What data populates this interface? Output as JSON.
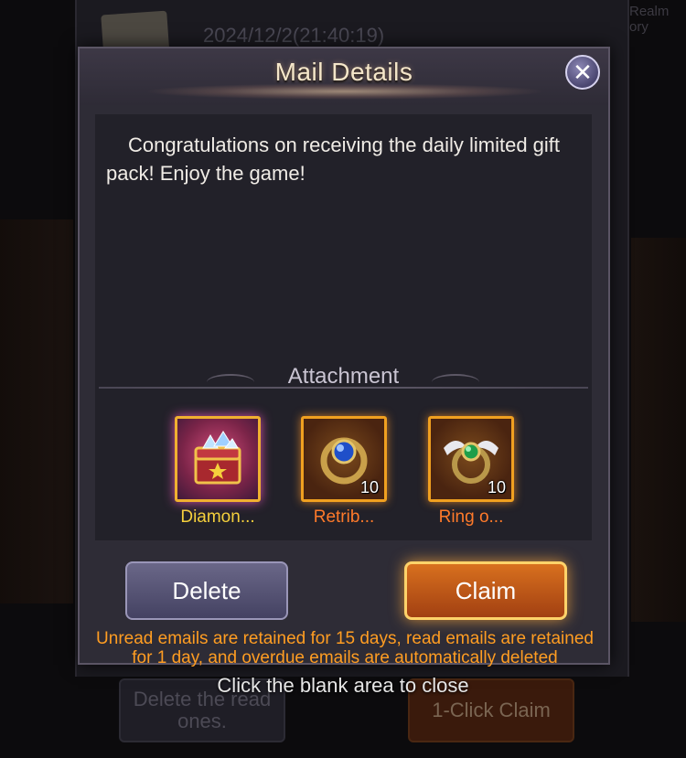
{
  "background": {
    "mail_date": "2024/12/2(21:40:19)",
    "side_text": "Realm ory",
    "delete_read_label": "Delete the read ones.",
    "one_click_claim_label": "1-Click Claim"
  },
  "dialog": {
    "title": "Mail Details",
    "close_icon": "close-x-icon",
    "message": "Congratulations on receiving the daily limited gift pack! Enjoy the game!",
    "attachment_label": "Attachment",
    "attachments": [
      {
        "name": "Diamon...",
        "count": "",
        "icon": "diamond-chest-icon",
        "rarity_color": "#e8409a"
      },
      {
        "name": "Retrib...",
        "count": "10",
        "icon": "blue-gem-ring-icon",
        "rarity_color": "#f0a020"
      },
      {
        "name": "Ring o...",
        "count": "10",
        "icon": "winged-green-ring-icon",
        "rarity_color": "#f0a020"
      }
    ],
    "delete_label": "Delete",
    "claim_label": "Claim",
    "retention_note": "Unread emails are retained for 15 days, read emails are retained for 1 day, and overdue emails are automatically deleted"
  },
  "close_hint": "Click the blank area to close",
  "colors": {
    "accent_orange": "#ff9d22",
    "item_name_yellow": "#f5d03c",
    "item_name_orange": "#ff7a2a"
  }
}
